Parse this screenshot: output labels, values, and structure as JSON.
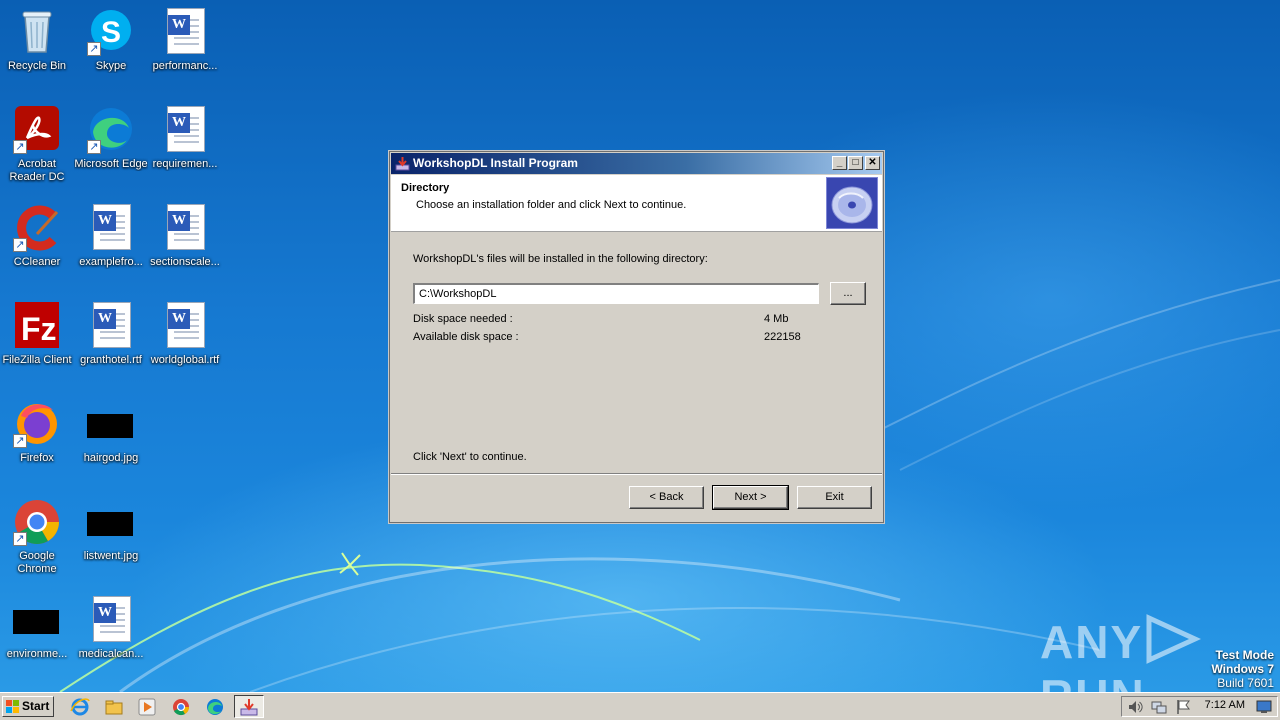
{
  "desktop": {
    "icons": [
      {
        "label": "Recycle Bin"
      },
      {
        "label": "Skype"
      },
      {
        "label": "performanc..."
      },
      {
        "label": "Acrobat Reader DC"
      },
      {
        "label": "Microsoft Edge"
      },
      {
        "label": "requiremen..."
      },
      {
        "label": "CCleaner"
      },
      {
        "label": "examplefro..."
      },
      {
        "label": "sectionscale..."
      },
      {
        "label": "FileZilla Client"
      },
      {
        "label": "granthotel.rtf"
      },
      {
        "label": "worldglobal.rtf"
      },
      {
        "label": "Firefox"
      },
      {
        "label": "hairgod.jpg"
      },
      {
        "label": "Google Chrome"
      },
      {
        "label": "listwent.jpg"
      },
      {
        "label": "environme..."
      },
      {
        "label": "medicalcan..."
      }
    ]
  },
  "dialog": {
    "title": "WorkshopDL Install Program",
    "header_title": "Directory",
    "header_subtitle": "Choose an installation folder and click Next to continue.",
    "intro_text": "WorkshopDL's files will be installed in the following directory:",
    "directory_value": "C:\\WorkshopDL",
    "browse_label": "...",
    "disk_needed_label": "Disk space needed :",
    "disk_needed_value": "4 Mb",
    "disk_available_label": "Available disk space :",
    "disk_available_value": "222158",
    "footer_text": "Click 'Next' to continue.",
    "back_label": "< Back",
    "next_label": "Next >",
    "exit_label": "Exit"
  },
  "watermark": {
    "brand_left": "ANY",
    "brand_right": "RUN",
    "test_mode": "Test Mode",
    "os_name": "Windows 7",
    "build": "Build 7601"
  },
  "taskbar": {
    "start_label": "Start",
    "clock": "7:12 AM"
  },
  "colors": {
    "titlebar_start": "#0a246a",
    "titlebar_end": "#a6caf0",
    "dialog_face": "#d4d0c8",
    "desktop_blue": "#1679d1"
  }
}
